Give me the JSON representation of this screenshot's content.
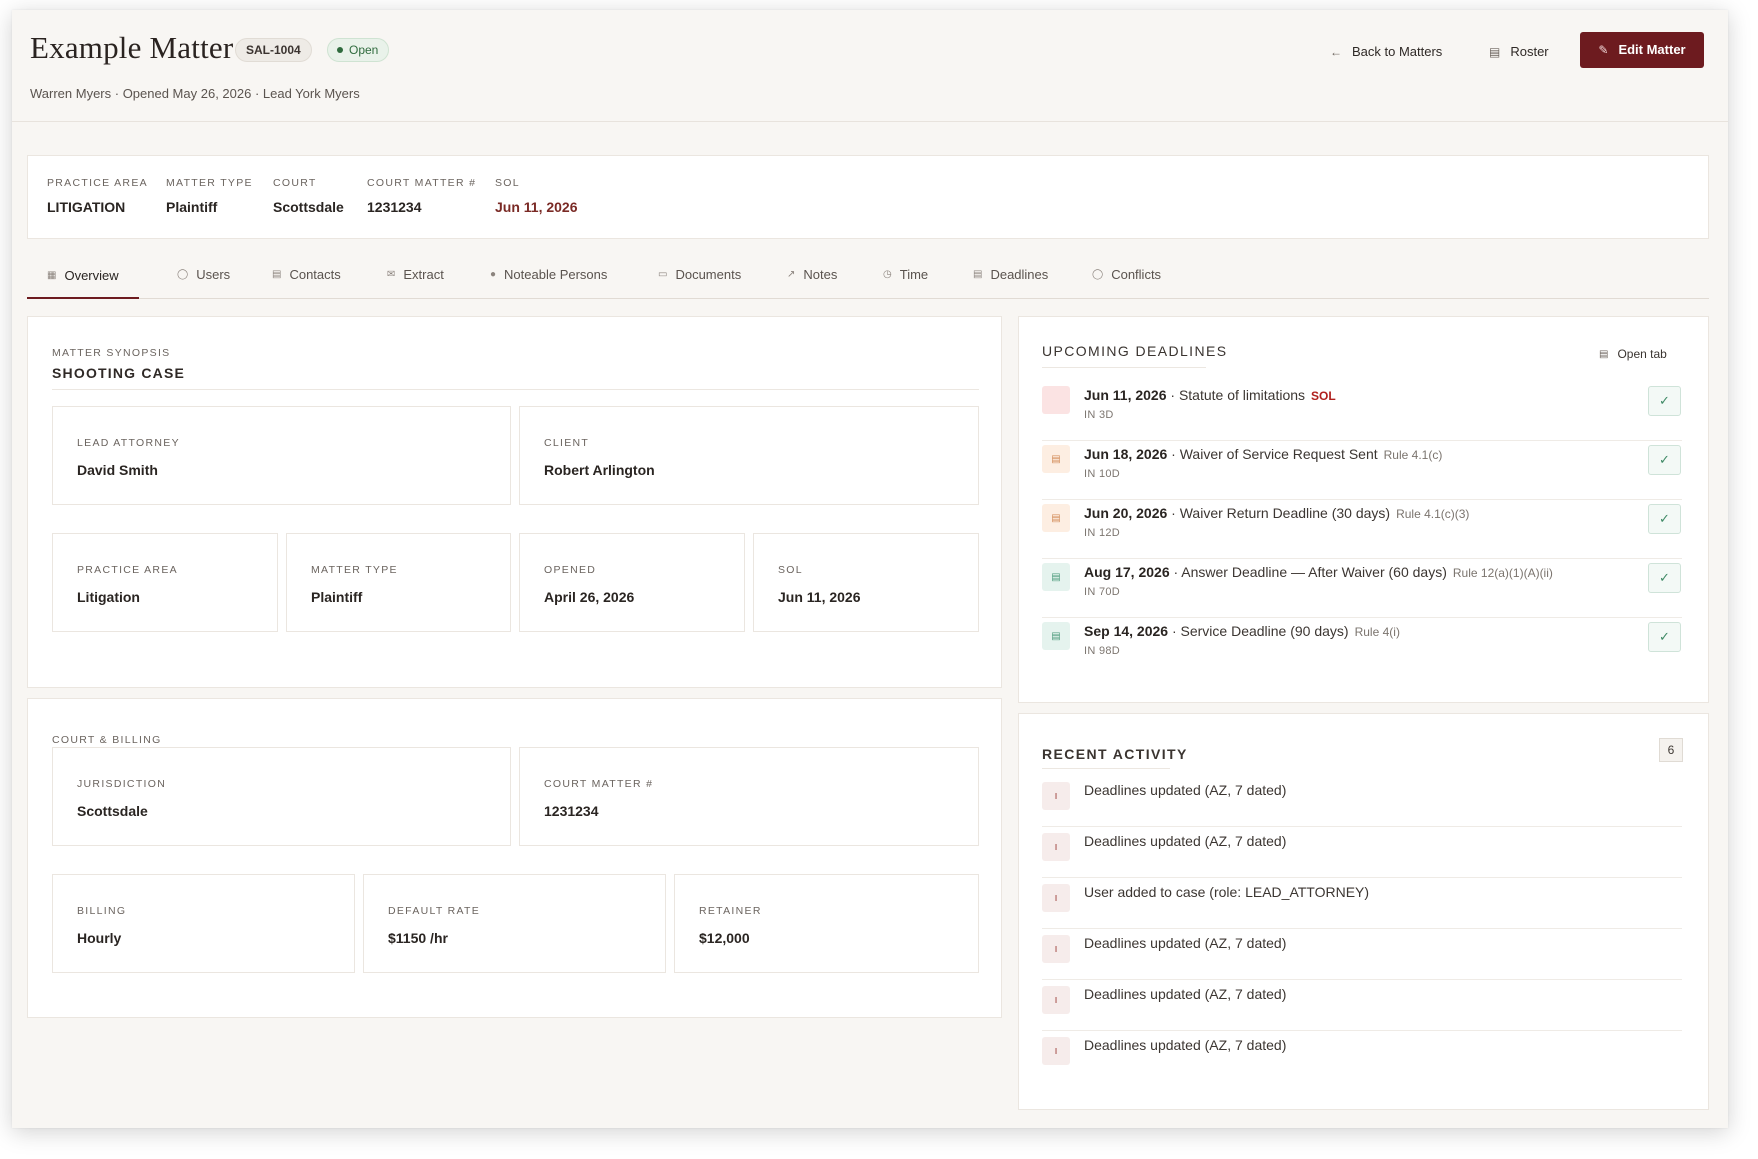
{
  "header": {
    "title": "Example Matter",
    "code": "SAL-1004",
    "status": "Open",
    "subtitle": "Warren Myers · Opened May 26, 2026 · Lead York Myers",
    "back_label": "Back to Matters",
    "roster_label": "Roster",
    "edit_label": "Edit Matter"
  },
  "summary": {
    "practice_area": {
      "label": "PRACTICE AREA",
      "value": "LITIGATION"
    },
    "matter_type": {
      "label": "MATTER TYPE",
      "value": "Plaintiff"
    },
    "court": {
      "label": "COURT",
      "value": "Scottsdale"
    },
    "court_matter": {
      "label": "COURT MATTER #",
      "value": "1231234"
    },
    "sol": {
      "label": "SOL",
      "value": "Jun 11, 2026"
    }
  },
  "tabs": [
    {
      "label": "Overview",
      "icon": "table-icon"
    },
    {
      "label": "Users",
      "icon": "user-icon"
    },
    {
      "label": "Contacts",
      "icon": "contact-card-icon"
    },
    {
      "label": "Extract",
      "icon": "mail-icon"
    },
    {
      "label": "Noteable Persons",
      "icon": "people-icon"
    },
    {
      "label": "Documents",
      "icon": "document-icon"
    },
    {
      "label": "Notes",
      "icon": "external-note-icon"
    },
    {
      "label": "Time",
      "icon": "clock-icon"
    },
    {
      "label": "Deadlines",
      "icon": "calendar-icon"
    },
    {
      "label": "Conflicts",
      "icon": "shield-icon"
    }
  ],
  "synopsis": {
    "heading": "MATTER SYNOPSIS",
    "subheading": "SHOOTING CASE",
    "lead_attorney": {
      "label": "LEAD ATTORNEY",
      "value": "David Smith"
    },
    "client": {
      "label": "CLIENT",
      "value": "Robert Arlington"
    },
    "practice_area": {
      "label": "PRACTICE AREA",
      "value": "Litigation"
    },
    "matter_type": {
      "label": "MATTER TYPE",
      "value": "Plaintiff"
    },
    "opened": {
      "label": "OPENED",
      "value": "April 26, 2026"
    },
    "sol": {
      "label": "SOL",
      "value": "Jun 11, 2026"
    }
  },
  "court_billing": {
    "heading": "COURT & BILLING",
    "jurisdiction": {
      "label": "JURISDICTION",
      "value": "Scottsdale"
    },
    "court_matter": {
      "label": "COURT MATTER #",
      "value": "1231234"
    },
    "billing": {
      "label": "BILLING",
      "value": "Hourly"
    },
    "default_rate": {
      "label": "DEFAULT RATE",
      "value": "$1150 /hr"
    },
    "retainer": {
      "label": "RETAINER",
      "value": "$12,000"
    }
  },
  "deadlines": {
    "heading": "UPCOMING DEADLINES",
    "open_tab_label": "Open tab",
    "items": [
      {
        "date": "Jun 11, 2026",
        "title": "· Statute of limitations",
        "rule": "",
        "tag": "SOL",
        "in": "IN 3D",
        "color": "#fbe3e3"
      },
      {
        "date": "Jun 18, 2026",
        "title": "· Waiver of Service Request Sent",
        "rule": "Rule 4.1(c)",
        "tag": "",
        "in": "IN 10D",
        "color": "#fdeee2"
      },
      {
        "date": "Jun 20, 2026",
        "title": "· Waiver Return Deadline (30 days)",
        "rule": "Rule 4.1(c)(3)",
        "tag": "",
        "in": "IN 12D",
        "color": "#fdeee2"
      },
      {
        "date": "Aug 17, 2026",
        "title": "· Answer Deadline — After Waiver (60 days)",
        "rule": "Rule 12(a)(1)(A)(ii)",
        "tag": "",
        "in": "IN 70D",
        "color": "#e5f3ee"
      },
      {
        "date": "Sep 14, 2026",
        "title": "· Service Deadline (90 days)",
        "rule": "Rule 4(i)",
        "tag": "",
        "in": "IN 98D",
        "color": "#e5f3ee"
      }
    ]
  },
  "activity": {
    "heading": "RECENT ACTIVITY",
    "count": "6",
    "items": [
      "Deadlines updated (AZ, 7 dated)",
      "Deadlines updated (AZ, 7 dated)",
      "User added to case (role: LEAD_ATTORNEY)",
      "Deadlines updated (AZ, 7 dated)",
      "Deadlines updated (AZ, 7 dated)",
      "Deadlines updated (AZ, 7 dated)"
    ]
  },
  "colors": {
    "accent": "#6d1b1f",
    "open_green": "#2f6b3e",
    "sol_red": "#b0201e"
  }
}
